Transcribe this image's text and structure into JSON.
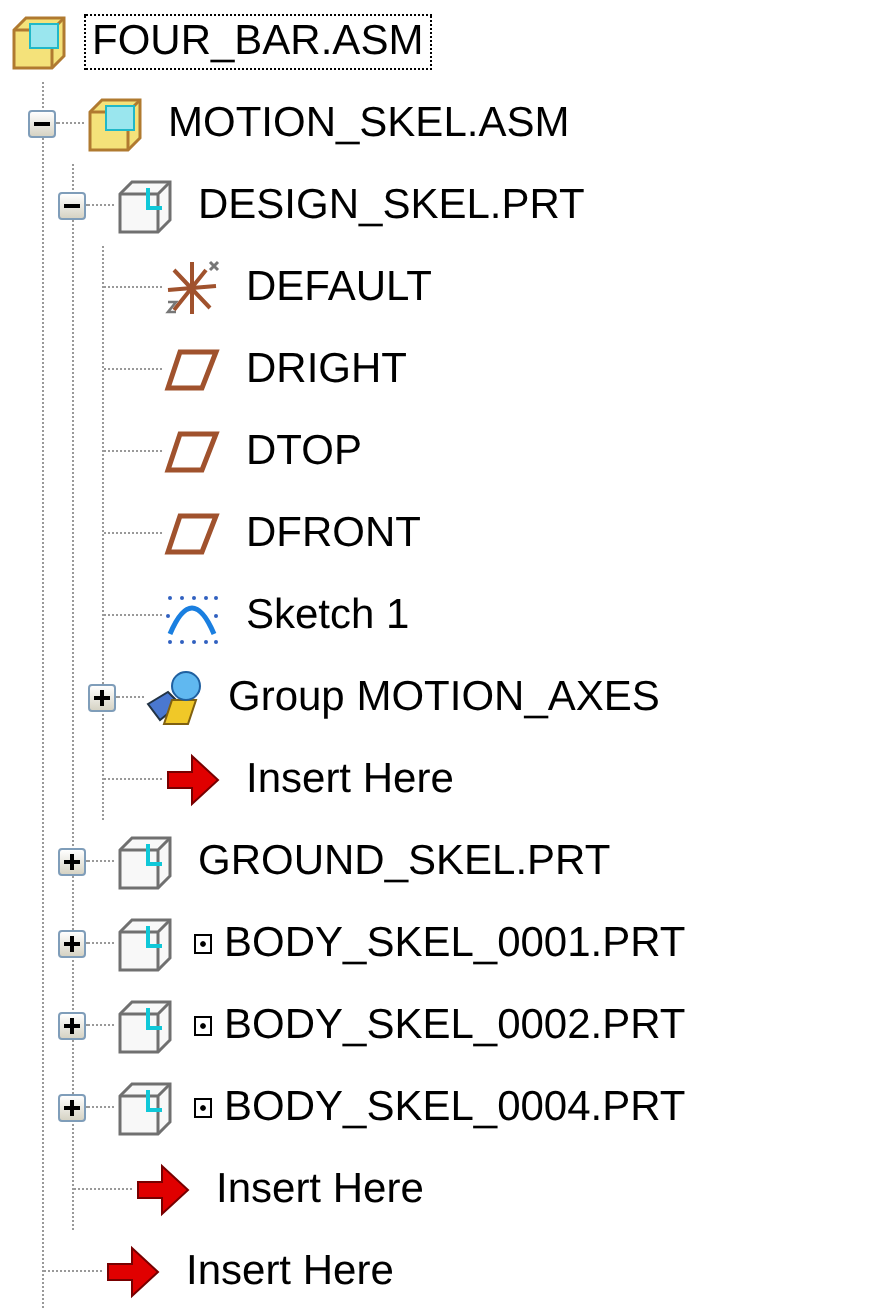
{
  "tree": [
    {
      "label": "FOUR_BAR.ASM",
      "kind": "assembly",
      "selected": true,
      "children": [
        {
          "label": "MOTION_SKEL.ASM",
          "kind": "assembly",
          "expanded": true,
          "selected": false,
          "children": [
            {
              "label": "DESIGN_SKEL.PRT",
              "kind": "part",
              "expanded": true,
              "selected": false,
              "children": [
                {
                  "label": "DEFAULT",
                  "kind": "csys",
                  "selected": false
                },
                {
                  "label": "DRIGHT",
                  "kind": "plane",
                  "selected": false
                },
                {
                  "label": "DTOP",
                  "kind": "plane",
                  "selected": false
                },
                {
                  "label": "DFRONT",
                  "kind": "plane",
                  "selected": false
                },
                {
                  "label": "Sketch 1",
                  "kind": "sketch",
                  "selected": false
                },
                {
                  "label": "Group MOTION_AXES",
                  "kind": "group",
                  "expanded": false,
                  "selected": false
                },
                {
                  "label": "Insert Here",
                  "kind": "insert",
                  "selected": false
                }
              ]
            },
            {
              "label": "GROUND_SKEL.PRT",
              "kind": "part",
              "expanded": false,
              "flagged": false,
              "selected": false
            },
            {
              "label": "BODY_SKEL_0001.PRT",
              "kind": "part",
              "expanded": false,
              "flagged": true,
              "selected": false
            },
            {
              "label": "BODY_SKEL_0002.PRT",
              "kind": "part",
              "expanded": false,
              "flagged": true,
              "selected": false
            },
            {
              "label": "BODY_SKEL_0004.PRT",
              "kind": "part",
              "expanded": false,
              "flagged": true,
              "selected": false
            },
            {
              "label": "Insert Here",
              "kind": "insert",
              "selected": false
            }
          ]
        },
        {
          "label": "Insert Here",
          "kind": "insert",
          "selected": false
        }
      ]
    }
  ]
}
